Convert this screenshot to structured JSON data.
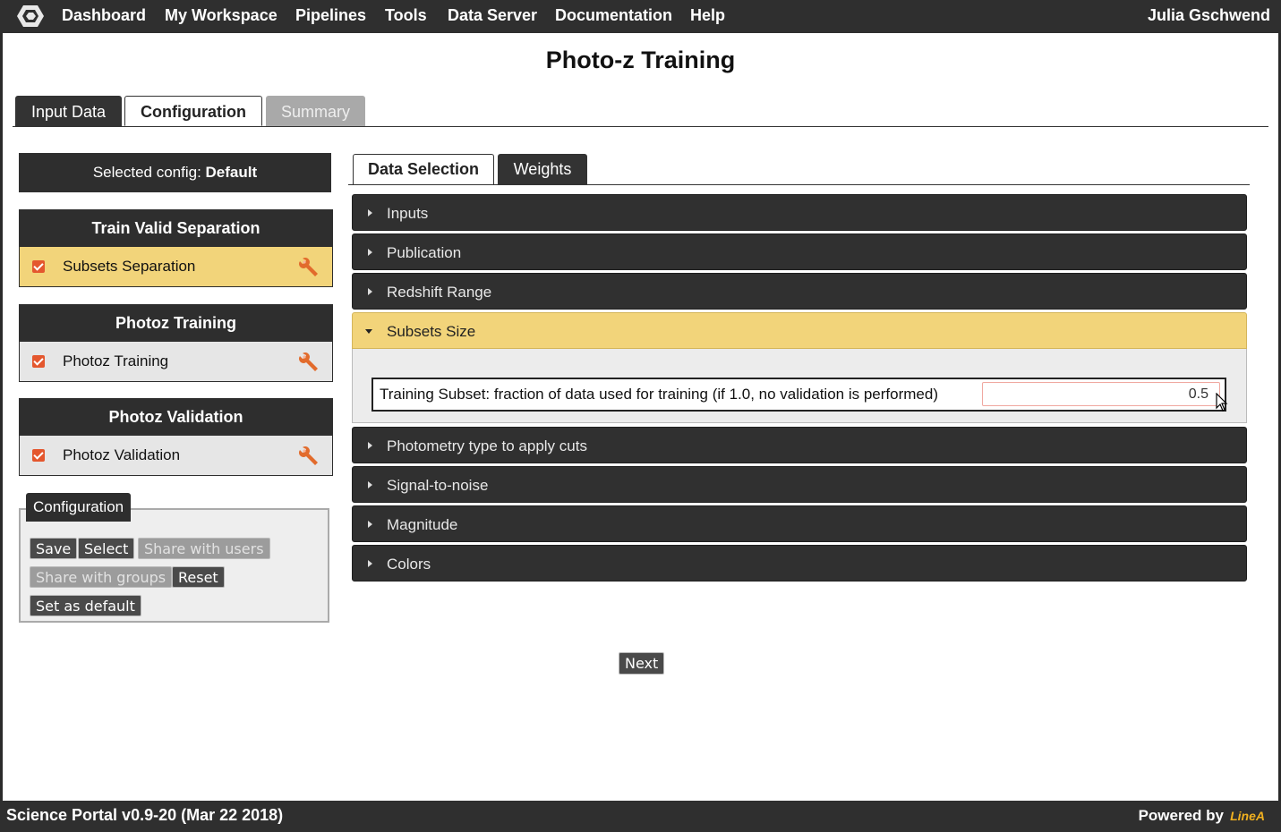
{
  "nav": {
    "items": [
      "Dashboard",
      "My Workspace",
      "Pipelines",
      "Tools",
      "Data Server",
      "Documentation",
      "Help"
    ],
    "user": "Julia Gschwend"
  },
  "page": {
    "title": "Photo-z Training"
  },
  "tabs": [
    {
      "label": "Input Data",
      "state": "normal"
    },
    {
      "label": "Configuration",
      "state": "active"
    },
    {
      "label": "Summary",
      "state": "disabled"
    }
  ],
  "sidebar": {
    "selected_label": "Selected config:",
    "selected_value": "Default",
    "panels": [
      {
        "title": "Train Valid Separation",
        "item": "Subsets Separation",
        "checked": true,
        "highlight": true
      },
      {
        "title": "Photoz Training",
        "item": "Photoz Training",
        "checked": true,
        "highlight": false
      },
      {
        "title": "Photoz Validation",
        "item": "Photoz Validation",
        "checked": true,
        "highlight": false
      }
    ],
    "config": {
      "legend": "Configuration",
      "buttons": {
        "save": "Save",
        "select": "Select",
        "share_users": "Share with users",
        "share_groups": "Share with groups",
        "reset": "Reset",
        "set_default": "Set as default"
      }
    }
  },
  "subtabs": [
    {
      "label": "Data Selection",
      "state": "active"
    },
    {
      "label": "Weights",
      "state": "normal"
    }
  ],
  "accordions": [
    {
      "label": "Inputs",
      "open": false
    },
    {
      "label": "Publication",
      "open": false
    },
    {
      "label": "Redshift Range",
      "open": false
    },
    {
      "label": "Subsets Size",
      "open": true
    },
    {
      "label": "Photometry type to apply cuts",
      "open": false
    },
    {
      "label": "Signal-to-noise",
      "open": false
    },
    {
      "label": "Magnitude",
      "open": false
    },
    {
      "label": "Colors",
      "open": false
    }
  ],
  "subsets_size": {
    "field_label": "Training Subset: fraction of data used for training (if 1.0, no validation is performed)",
    "field_value": "0.5"
  },
  "next_label": "Next",
  "footer": {
    "version": "Science Portal v0.9-20 (Mar 22 2018)",
    "powered_by": "Powered by",
    "logo_text": "LineA"
  },
  "colors": {
    "dark": "#2f2f2f",
    "highlight": "#f2d47a",
    "checkbox": "#e4572e",
    "logo": "#f0b020"
  }
}
